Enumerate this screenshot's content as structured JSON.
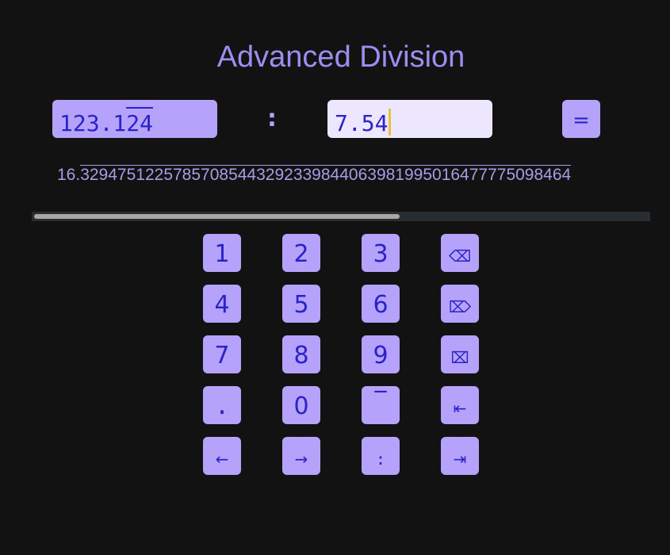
{
  "title": "Advanced Division",
  "dividend": {
    "nonrepeating": "123.1",
    "repeating": "24"
  },
  "divisor": {
    "value": "7.54"
  },
  "operator": ":",
  "equals_label": "=",
  "result": {
    "prefix": "16.",
    "repeating": "3294751225785708544329233984406398199501647777509846​4"
  },
  "scroll": {
    "position_fraction": 0.59
  },
  "keypad": [
    [
      "1",
      "2",
      "3",
      "⌫"
    ],
    [
      "4",
      "5",
      "6",
      "⌦"
    ],
    [
      "7",
      "8",
      "9",
      "⌧"
    ],
    [
      ".",
      "0",
      "‾",
      "⇤"
    ],
    [
      "←",
      "→",
      ":",
      "⇥"
    ]
  ],
  "colors": {
    "accent": "#b4a2fb",
    "key_text": "#2b22c9",
    "background": "#121212",
    "caret": "#e7c23a"
  }
}
